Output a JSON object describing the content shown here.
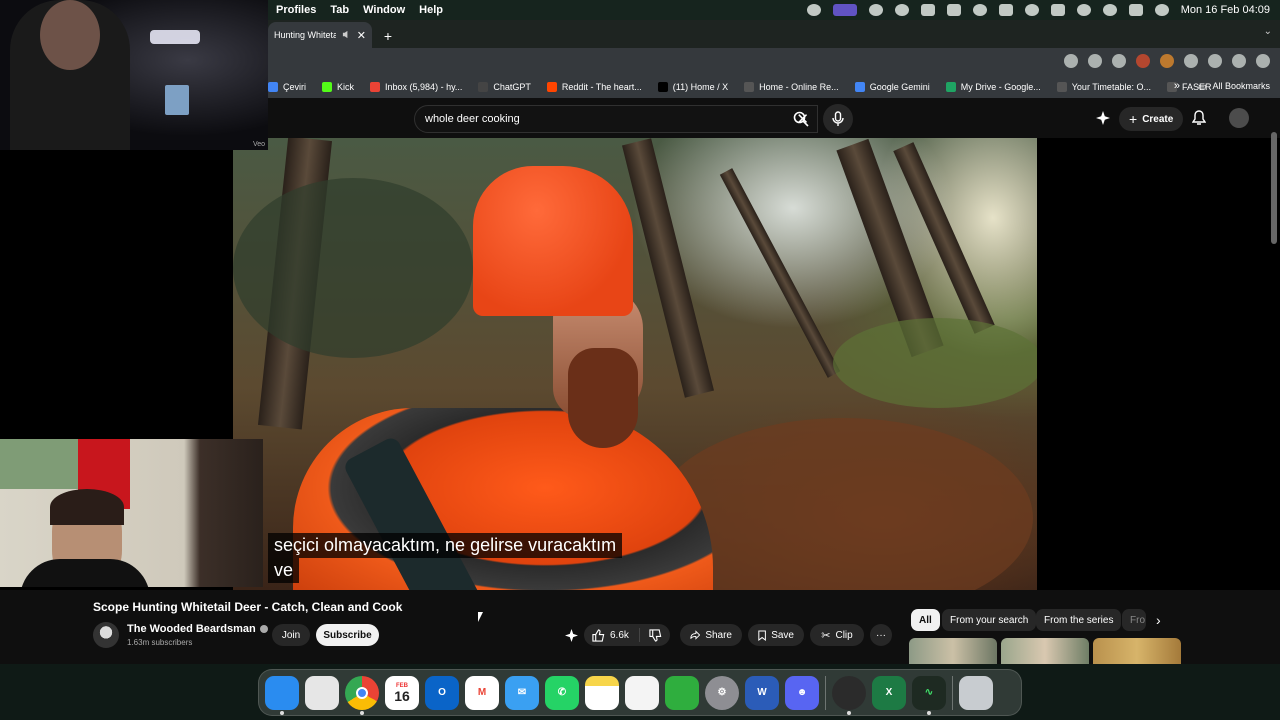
{
  "menubar": {
    "menus": [
      "Profiles",
      "Tab",
      "Window",
      "Help"
    ],
    "clock": "Mon 16 Feb  04:09"
  },
  "browser": {
    "tab_title": "Hunting Whitetail D",
    "new_tab": "+",
    "bookmarks": [
      {
        "label": "Çeviri",
        "color": "#4285f4"
      },
      {
        "label": "Kick",
        "color": "#53fc18"
      },
      {
        "label": "Inbox (5,984) - hy...",
        "color": "#ea4335"
      },
      {
        "label": "ChatGPT",
        "color": "#444444"
      },
      {
        "label": "Reddit - The heart...",
        "color": "#ff4500"
      },
      {
        "label": "(11) Home / X",
        "color": "#000000"
      },
      {
        "label": "Home - Online Re...",
        "color": "#555555"
      },
      {
        "label": "Google Gemini",
        "color": "#4285f4"
      },
      {
        "label": "My Drive - Google...",
        "color": "#1fa463"
      },
      {
        "label": "Your Timetable: O...",
        "color": "#555555"
      },
      {
        "label": "FASER",
        "color": "#555555"
      }
    ],
    "more_bookmarks": "»",
    "all_bookmarks": "All Bookmarks"
  },
  "youtube": {
    "search_value": "whole deer cooking",
    "create_label": "Create",
    "video": {
      "watermark": "Veo",
      "subtitle_line1": "seçici olmayacaktım, ne gelirse vuracaktım",
      "subtitle_line2": "ve"
    },
    "title": "Scope Hunting Whitetail Deer - Catch, Clean and Cook",
    "channel": {
      "name": "The Wooded Beardsman",
      "subscribers": "1.63m subscribers",
      "join": "Join",
      "subscribe": "Subscribe"
    },
    "actions": {
      "likes": "6.6k",
      "share": "Share",
      "save": "Save",
      "clip": "Clip",
      "more": "···"
    },
    "chips": [
      "All",
      "From your search",
      "From the series",
      "Fro"
    ]
  },
  "webcam_label": "Veo",
  "dock": {
    "apps": [
      {
        "name": "Finder",
        "label": "",
        "color": "#2a8cf0"
      },
      {
        "name": "Launchpad",
        "label": "",
        "color": "#e6e6e6"
      },
      {
        "name": "Chrome",
        "label": "",
        "color": "#ffffff"
      },
      {
        "name": "Calendar",
        "label": "16",
        "color": "#ffffff"
      },
      {
        "name": "Outlook",
        "label": "",
        "color": "#0a64c8"
      },
      {
        "name": "Gmail",
        "label": "",
        "color": "#ffffff"
      },
      {
        "name": "Mail",
        "label": "",
        "color": "#3aa0f2"
      },
      {
        "name": "WhatsApp",
        "label": "",
        "color": "#25d366"
      },
      {
        "name": "Notes",
        "label": "",
        "color": "#f7d54a"
      },
      {
        "name": "Reminders",
        "label": "",
        "color": "#f4f4f4"
      },
      {
        "name": "Numbers",
        "label": "",
        "color": "#2fae3e"
      },
      {
        "name": "System Settings",
        "label": "",
        "color": "#8e8e93"
      },
      {
        "name": "Word",
        "label": "W",
        "color": "#2b5cb8"
      },
      {
        "name": "Discord",
        "label": "",
        "color": "#5865f2"
      },
      {
        "name": "OBS",
        "label": "",
        "color": "#2b2b2b"
      },
      {
        "name": "Excel",
        "label": "X",
        "color": "#1d7a44"
      },
      {
        "name": "Activity Monitor",
        "label": "",
        "color": "#1e2a22"
      },
      {
        "name": "Trash",
        "label": "",
        "color": "#c8ccd0"
      }
    ],
    "calendar_month": "FEB"
  }
}
